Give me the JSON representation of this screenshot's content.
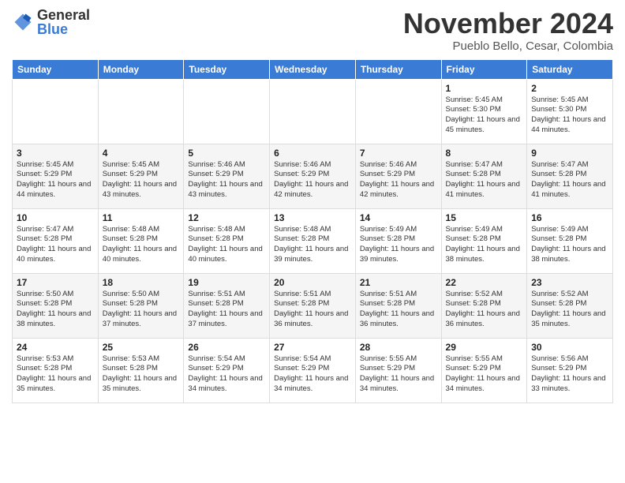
{
  "logo": {
    "general": "General",
    "blue": "Blue"
  },
  "title": "November 2024",
  "location": "Pueblo Bello, Cesar, Colombia",
  "days_of_week": [
    "Sunday",
    "Monday",
    "Tuesday",
    "Wednesday",
    "Thursday",
    "Friday",
    "Saturday"
  ],
  "weeks": [
    [
      {
        "day": "",
        "info": ""
      },
      {
        "day": "",
        "info": ""
      },
      {
        "day": "",
        "info": ""
      },
      {
        "day": "",
        "info": ""
      },
      {
        "day": "",
        "info": ""
      },
      {
        "day": "1",
        "info": "Sunrise: 5:45 AM\nSunset: 5:30 PM\nDaylight: 11 hours and 45 minutes."
      },
      {
        "day": "2",
        "info": "Sunrise: 5:45 AM\nSunset: 5:30 PM\nDaylight: 11 hours and 44 minutes."
      }
    ],
    [
      {
        "day": "3",
        "info": "Sunrise: 5:45 AM\nSunset: 5:29 PM\nDaylight: 11 hours and 44 minutes."
      },
      {
        "day": "4",
        "info": "Sunrise: 5:45 AM\nSunset: 5:29 PM\nDaylight: 11 hours and 43 minutes."
      },
      {
        "day": "5",
        "info": "Sunrise: 5:46 AM\nSunset: 5:29 PM\nDaylight: 11 hours and 43 minutes."
      },
      {
        "day": "6",
        "info": "Sunrise: 5:46 AM\nSunset: 5:29 PM\nDaylight: 11 hours and 42 minutes."
      },
      {
        "day": "7",
        "info": "Sunrise: 5:46 AM\nSunset: 5:29 PM\nDaylight: 11 hours and 42 minutes."
      },
      {
        "day": "8",
        "info": "Sunrise: 5:47 AM\nSunset: 5:28 PM\nDaylight: 11 hours and 41 minutes."
      },
      {
        "day": "9",
        "info": "Sunrise: 5:47 AM\nSunset: 5:28 PM\nDaylight: 11 hours and 41 minutes."
      }
    ],
    [
      {
        "day": "10",
        "info": "Sunrise: 5:47 AM\nSunset: 5:28 PM\nDaylight: 11 hours and 40 minutes."
      },
      {
        "day": "11",
        "info": "Sunrise: 5:48 AM\nSunset: 5:28 PM\nDaylight: 11 hours and 40 minutes."
      },
      {
        "day": "12",
        "info": "Sunrise: 5:48 AM\nSunset: 5:28 PM\nDaylight: 11 hours and 40 minutes."
      },
      {
        "day": "13",
        "info": "Sunrise: 5:48 AM\nSunset: 5:28 PM\nDaylight: 11 hours and 39 minutes."
      },
      {
        "day": "14",
        "info": "Sunrise: 5:49 AM\nSunset: 5:28 PM\nDaylight: 11 hours and 39 minutes."
      },
      {
        "day": "15",
        "info": "Sunrise: 5:49 AM\nSunset: 5:28 PM\nDaylight: 11 hours and 38 minutes."
      },
      {
        "day": "16",
        "info": "Sunrise: 5:49 AM\nSunset: 5:28 PM\nDaylight: 11 hours and 38 minutes."
      }
    ],
    [
      {
        "day": "17",
        "info": "Sunrise: 5:50 AM\nSunset: 5:28 PM\nDaylight: 11 hours and 38 minutes."
      },
      {
        "day": "18",
        "info": "Sunrise: 5:50 AM\nSunset: 5:28 PM\nDaylight: 11 hours and 37 minutes."
      },
      {
        "day": "19",
        "info": "Sunrise: 5:51 AM\nSunset: 5:28 PM\nDaylight: 11 hours and 37 minutes."
      },
      {
        "day": "20",
        "info": "Sunrise: 5:51 AM\nSunset: 5:28 PM\nDaylight: 11 hours and 36 minutes."
      },
      {
        "day": "21",
        "info": "Sunrise: 5:51 AM\nSunset: 5:28 PM\nDaylight: 11 hours and 36 minutes."
      },
      {
        "day": "22",
        "info": "Sunrise: 5:52 AM\nSunset: 5:28 PM\nDaylight: 11 hours and 36 minutes."
      },
      {
        "day": "23",
        "info": "Sunrise: 5:52 AM\nSunset: 5:28 PM\nDaylight: 11 hours and 35 minutes."
      }
    ],
    [
      {
        "day": "24",
        "info": "Sunrise: 5:53 AM\nSunset: 5:28 PM\nDaylight: 11 hours and 35 minutes."
      },
      {
        "day": "25",
        "info": "Sunrise: 5:53 AM\nSunset: 5:28 PM\nDaylight: 11 hours and 35 minutes."
      },
      {
        "day": "26",
        "info": "Sunrise: 5:54 AM\nSunset: 5:29 PM\nDaylight: 11 hours and 34 minutes."
      },
      {
        "day": "27",
        "info": "Sunrise: 5:54 AM\nSunset: 5:29 PM\nDaylight: 11 hours and 34 minutes."
      },
      {
        "day": "28",
        "info": "Sunrise: 5:55 AM\nSunset: 5:29 PM\nDaylight: 11 hours and 34 minutes."
      },
      {
        "day": "29",
        "info": "Sunrise: 5:55 AM\nSunset: 5:29 PM\nDaylight: 11 hours and 34 minutes."
      },
      {
        "day": "30",
        "info": "Sunrise: 5:56 AM\nSunset: 5:29 PM\nDaylight: 11 hours and 33 minutes."
      }
    ]
  ]
}
